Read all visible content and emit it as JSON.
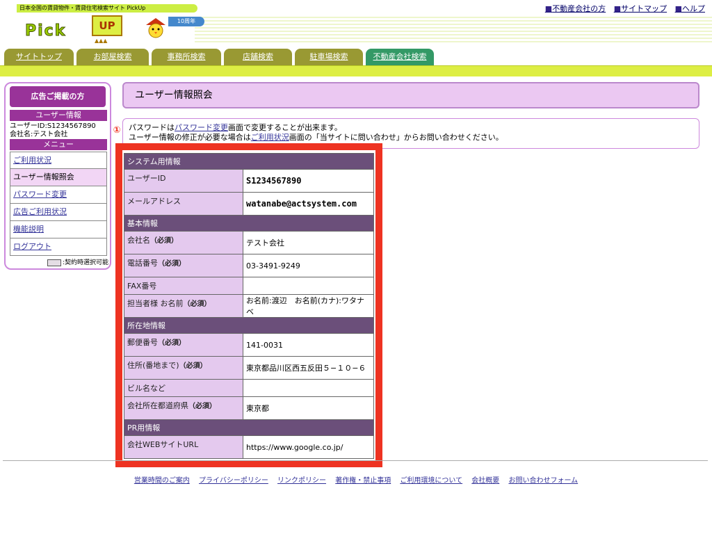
{
  "header": {
    "tagline": "日本全国の賃貸物件・賃貸住宅検索サイト PickUp",
    "logo_text": "Pick",
    "logo_up": "UP",
    "logo_flag": "10周年",
    "top_links": [
      "不動産会社の方",
      "サイトマップ",
      "ヘルプ"
    ]
  },
  "tabs": [
    {
      "label": "サイトトップ",
      "color": "#999933"
    },
    {
      "label": "お部屋検索",
      "color": "#999933"
    },
    {
      "label": "事務所検索",
      "color": "#999933"
    },
    {
      "label": "店舗検索",
      "color": "#999933"
    },
    {
      "label": "駐車場検索",
      "color": "#999933"
    },
    {
      "label": "不動産会社検索",
      "color": "#339966"
    }
  ],
  "sidebar": {
    "ad_button": "広告ご掲載の方",
    "user_heading": "ユーザー情報",
    "user_id_line": "ユーザーID:S1234567890",
    "company_line": "会社名:テスト会社",
    "menu_heading": "メニュー",
    "menu": [
      {
        "label": "ご利用状況",
        "active": false
      },
      {
        "label": "ユーザー情報照会",
        "active": true
      },
      {
        "label": "パスワード変更",
        "active": false
      },
      {
        "label": "広告ご利用状況",
        "active": false
      },
      {
        "label": "機能説明",
        "active": false
      },
      {
        "label": "ログアウト",
        "active": false
      }
    ],
    "legend": ":契約時選択可能"
  },
  "main": {
    "title": "ユーザー情報照会",
    "notice": {
      "l1_pre": "パスワードは",
      "l1_link": "パスワード変更",
      "l1_post": "画面で変更することが出来ます。",
      "l2_pre": "ユーザー情報の修正が必要な場合は",
      "l2_link": "ご利用状況",
      "l2_post": "画面の「当サイトに問い合わせ」からお問い合わせください。"
    },
    "marker": "①",
    "sections": [
      {
        "title": "システム用情報",
        "rows": [
          {
            "label": "ユーザーID",
            "required": "",
            "value": "S1234567890",
            "mono": true
          },
          {
            "label": "メールアドレス",
            "required": "",
            "value": "watanabe@actsystem.com",
            "mono": true
          }
        ]
      },
      {
        "title": "基本情報",
        "rows": [
          {
            "label": "会社名",
            "required": "（必須）",
            "value": "テスト会社",
            "mono": false
          },
          {
            "label": "電話番号",
            "required": "（必須）",
            "value": "03-3491-9249",
            "mono": false
          },
          {
            "label": "FAX番号",
            "required": "",
            "value": "",
            "mono": false
          },
          {
            "label": "担当者様 お名前",
            "required": "（必須）",
            "value": "お名前:渡辺　お名前(カナ):ワタナベ",
            "mono": false
          }
        ]
      },
      {
        "title": "所在地情報",
        "rows": [
          {
            "label": "郵便番号",
            "required": "（必須）",
            "value": "141-0031",
            "mono": false
          },
          {
            "label": "住所(番地まで)",
            "required": "（必須）",
            "value": "東京都品川区西五反田５−１０−６",
            "mono": false
          },
          {
            "label": "ビル名など",
            "required": "",
            "value": "",
            "mono": false
          },
          {
            "label": "会社所在都道府県",
            "required": "（必須）",
            "value": "東京都",
            "mono": false
          }
        ]
      },
      {
        "title": "PR用情報",
        "rows": [
          {
            "label": "会社WEBサイトURL",
            "required": "",
            "value": "https://www.google.co.jp/",
            "mono": false
          }
        ]
      }
    ]
  },
  "footer": {
    "links": [
      "営業時間のご案内",
      "プライバシーポリシー",
      "リンクポリシー",
      "著作権・禁止事項",
      "ご利用環境について",
      "会社概要",
      "お問い合わせフォーム"
    ]
  }
}
